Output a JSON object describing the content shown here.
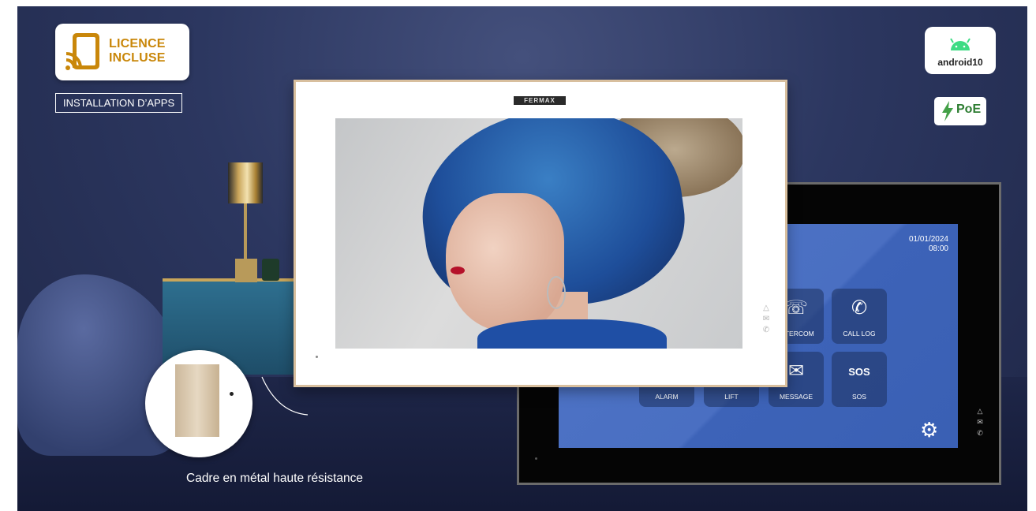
{
  "badges": {
    "licence_line1": "LICENCE",
    "licence_line2": "INCLUSE",
    "apps_label": "INSTALLATION D’APPS",
    "android": "android10",
    "poe": "PoE"
  },
  "device_front": {
    "brand": "FERMAX",
    "side_icons": [
      "bell-icon",
      "envelope-icon",
      "phone-icon"
    ]
  },
  "device_back": {
    "date": "01/01/2024",
    "time": "08:00",
    "tiles": [
      {
        "label": "INTERCOM",
        "icon": "intercom-icon",
        "glyph": "☏"
      },
      {
        "label": "CALL LOG",
        "icon": "phone-icon",
        "glyph": "✆"
      },
      {
        "label": "ALARM",
        "icon": "alarm-icon",
        "glyph": "⚠"
      },
      {
        "label": "LIFT",
        "icon": "lift-icon",
        "glyph": "⇅"
      },
      {
        "label": "MESSAGE",
        "icon": "envelope-icon",
        "glyph": "✉"
      },
      {
        "label": "SOS",
        "icon": "sos-icon",
        "glyph": "SOS"
      }
    ],
    "settings_icon": "gear-icon",
    "side_icons": [
      "bell-icon",
      "envelope-icon",
      "phone-icon"
    ]
  },
  "caption": "Cadre en métal haute résistance",
  "colors": {
    "licence_accent": "#c9870a",
    "background": "#2c3760",
    "screen_blue": "#4a6fc2",
    "android_green": "#3ddc84"
  }
}
